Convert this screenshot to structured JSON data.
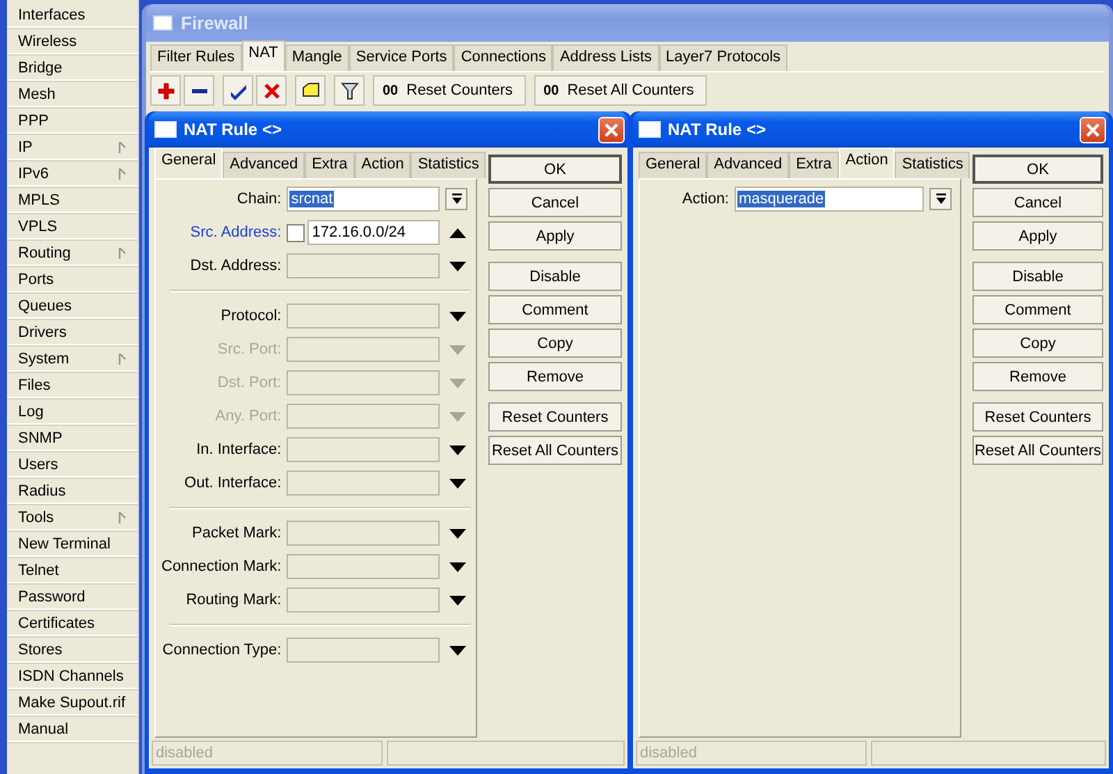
{
  "sidebar": {
    "items": [
      {
        "label": "Interfaces",
        "submenu": false
      },
      {
        "label": "Wireless",
        "submenu": false
      },
      {
        "label": "Bridge",
        "submenu": false
      },
      {
        "label": "Mesh",
        "submenu": false
      },
      {
        "label": "PPP",
        "submenu": false
      },
      {
        "label": "IP",
        "submenu": true
      },
      {
        "label": "IPv6",
        "submenu": true
      },
      {
        "label": "MPLS",
        "submenu": false
      },
      {
        "label": "VPLS",
        "submenu": false
      },
      {
        "label": "Routing",
        "submenu": true
      },
      {
        "label": "Ports",
        "submenu": false
      },
      {
        "label": "Queues",
        "submenu": false
      },
      {
        "label": "Drivers",
        "submenu": false
      },
      {
        "label": "System",
        "submenu": true
      },
      {
        "label": "Files",
        "submenu": false
      },
      {
        "label": "Log",
        "submenu": false
      },
      {
        "label": "SNMP",
        "submenu": false
      },
      {
        "label": "Users",
        "submenu": false
      },
      {
        "label": "Radius",
        "submenu": false
      },
      {
        "label": "Tools",
        "submenu": true
      },
      {
        "label": "New Terminal",
        "submenu": false
      },
      {
        "label": "Telnet",
        "submenu": false
      },
      {
        "label": "Password",
        "submenu": false
      },
      {
        "label": "Certificates",
        "submenu": false
      },
      {
        "label": "Stores",
        "submenu": false
      },
      {
        "label": "ISDN Channels",
        "submenu": false
      },
      {
        "label": "Make Supout.rif",
        "submenu": false
      },
      {
        "label": "Manual",
        "submenu": false
      }
    ]
  },
  "firewall": {
    "title": "Firewall",
    "tabs": [
      {
        "label": "Filter Rules",
        "selected": false
      },
      {
        "label": "NAT",
        "selected": true
      },
      {
        "label": "Mangle",
        "selected": false
      },
      {
        "label": "Service Ports",
        "selected": false
      },
      {
        "label": "Connections",
        "selected": false
      },
      {
        "label": "Address Lists",
        "selected": false
      },
      {
        "label": "Layer7 Protocols",
        "selected": false
      }
    ],
    "toolbar": [
      {
        "kind": "add"
      },
      {
        "kind": "remove"
      },
      {
        "kind": "enable"
      },
      {
        "kind": "disable"
      },
      {
        "kind": "comment"
      },
      {
        "kind": "filter"
      },
      {
        "kind": "counter",
        "glyph": "00",
        "label": "Reset Counters"
      },
      {
        "kind": "counter",
        "glyph": "00",
        "label": "Reset All Counters"
      }
    ]
  },
  "dialogs": [
    {
      "title": "NAT Rule <>",
      "tabs": [
        {
          "label": "General",
          "selected": true
        },
        {
          "label": "Advanced",
          "selected": false
        },
        {
          "label": "Extra",
          "selected": false
        },
        {
          "label": "Action",
          "selected": false
        },
        {
          "label": "Statistics",
          "selected": false
        }
      ],
      "fields": [
        {
          "kind": "field",
          "label": "Chain:",
          "value": "srcnat",
          "value_selected": true,
          "arrow": {
            "kind": "list"
          },
          "disabled": false
        },
        {
          "kind": "field",
          "label": "Src. Address:",
          "value": "172.16.0.0/24",
          "value_selected": false,
          "label_link": true,
          "checkbox": {
            "checked": false
          },
          "arrow": {
            "kind": "up"
          },
          "disabled": false
        },
        {
          "kind": "field",
          "label": "Dst. Address:",
          "arrow": {
            "kind": "down"
          },
          "disabled": false
        },
        {
          "kind": "separator"
        },
        {
          "kind": "field",
          "label": "Protocol:",
          "arrow": {
            "kind": "down"
          },
          "disabled": false
        },
        {
          "kind": "field",
          "label": "Src. Port:",
          "arrow": {
            "kind": "down"
          },
          "disabled": true
        },
        {
          "kind": "field",
          "label": "Dst. Port:",
          "arrow": {
            "kind": "down"
          },
          "disabled": true
        },
        {
          "kind": "field",
          "label": "Any. Port:",
          "arrow": {
            "kind": "down"
          },
          "disabled": true
        },
        {
          "kind": "field",
          "label": "In. Interface:",
          "arrow": {
            "kind": "down"
          },
          "disabled": false
        },
        {
          "kind": "field",
          "label": "Out. Interface:",
          "arrow": {
            "kind": "down"
          },
          "disabled": false
        },
        {
          "kind": "separator"
        },
        {
          "kind": "field",
          "label": "Packet Mark:",
          "arrow": {
            "kind": "down"
          },
          "disabled": false
        },
        {
          "kind": "field",
          "label": "Connection Mark:",
          "arrow": {
            "kind": "down"
          },
          "disabled": false
        },
        {
          "kind": "field",
          "label": "Routing Mark:",
          "arrow": {
            "kind": "down"
          },
          "disabled": false
        },
        {
          "kind": "separator"
        },
        {
          "kind": "field",
          "label": "Connection Type:",
          "arrow": {
            "kind": "down"
          },
          "disabled": false
        }
      ],
      "button_groups": [
        {
          "buttons": [
            {
              "label": "OK",
              "default": true
            },
            {
              "label": "Cancel",
              "default": false
            },
            {
              "label": "Apply",
              "default": false
            }
          ]
        },
        {
          "buttons": [
            {
              "label": "Disable",
              "default": false
            },
            {
              "label": "Comment",
              "default": false
            },
            {
              "label": "Copy",
              "default": false
            },
            {
              "label": "Remove",
              "default": false
            }
          ]
        },
        {
          "buttons": [
            {
              "label": "Reset Counters",
              "default": false
            },
            {
              "label": "Reset All Counters",
              "default": false
            }
          ]
        }
      ],
      "status_bar": {
        "text": "disabled"
      }
    },
    {
      "title": "NAT Rule <>",
      "tabs": [
        {
          "label": "General",
          "selected": false
        },
        {
          "label": "Advanced",
          "selected": false
        },
        {
          "label": "Extra",
          "selected": false
        },
        {
          "label": "Action",
          "selected": true
        },
        {
          "label": "Statistics",
          "selected": false
        }
      ],
      "fields": [
        {
          "kind": "field",
          "label": "Action:",
          "value": "masquerade",
          "value_selected": true,
          "arrow": {
            "kind": "list"
          },
          "disabled": false
        }
      ],
      "button_groups": [
        {
          "buttons": [
            {
              "label": "OK",
              "default": true
            },
            {
              "label": "Cancel",
              "default": false
            },
            {
              "label": "Apply",
              "default": false
            }
          ]
        },
        {
          "buttons": [
            {
              "label": "Disable",
              "default": false
            },
            {
              "label": "Comment",
              "default": false
            },
            {
              "label": "Copy",
              "default": false
            },
            {
              "label": "Remove",
              "default": false
            }
          ]
        },
        {
          "buttons": [
            {
              "label": "Reset Counters",
              "default": false
            },
            {
              "label": "Reset All Counters",
              "default": false
            }
          ]
        }
      ],
      "status_bar": {
        "text": "disabled"
      }
    }
  ]
}
